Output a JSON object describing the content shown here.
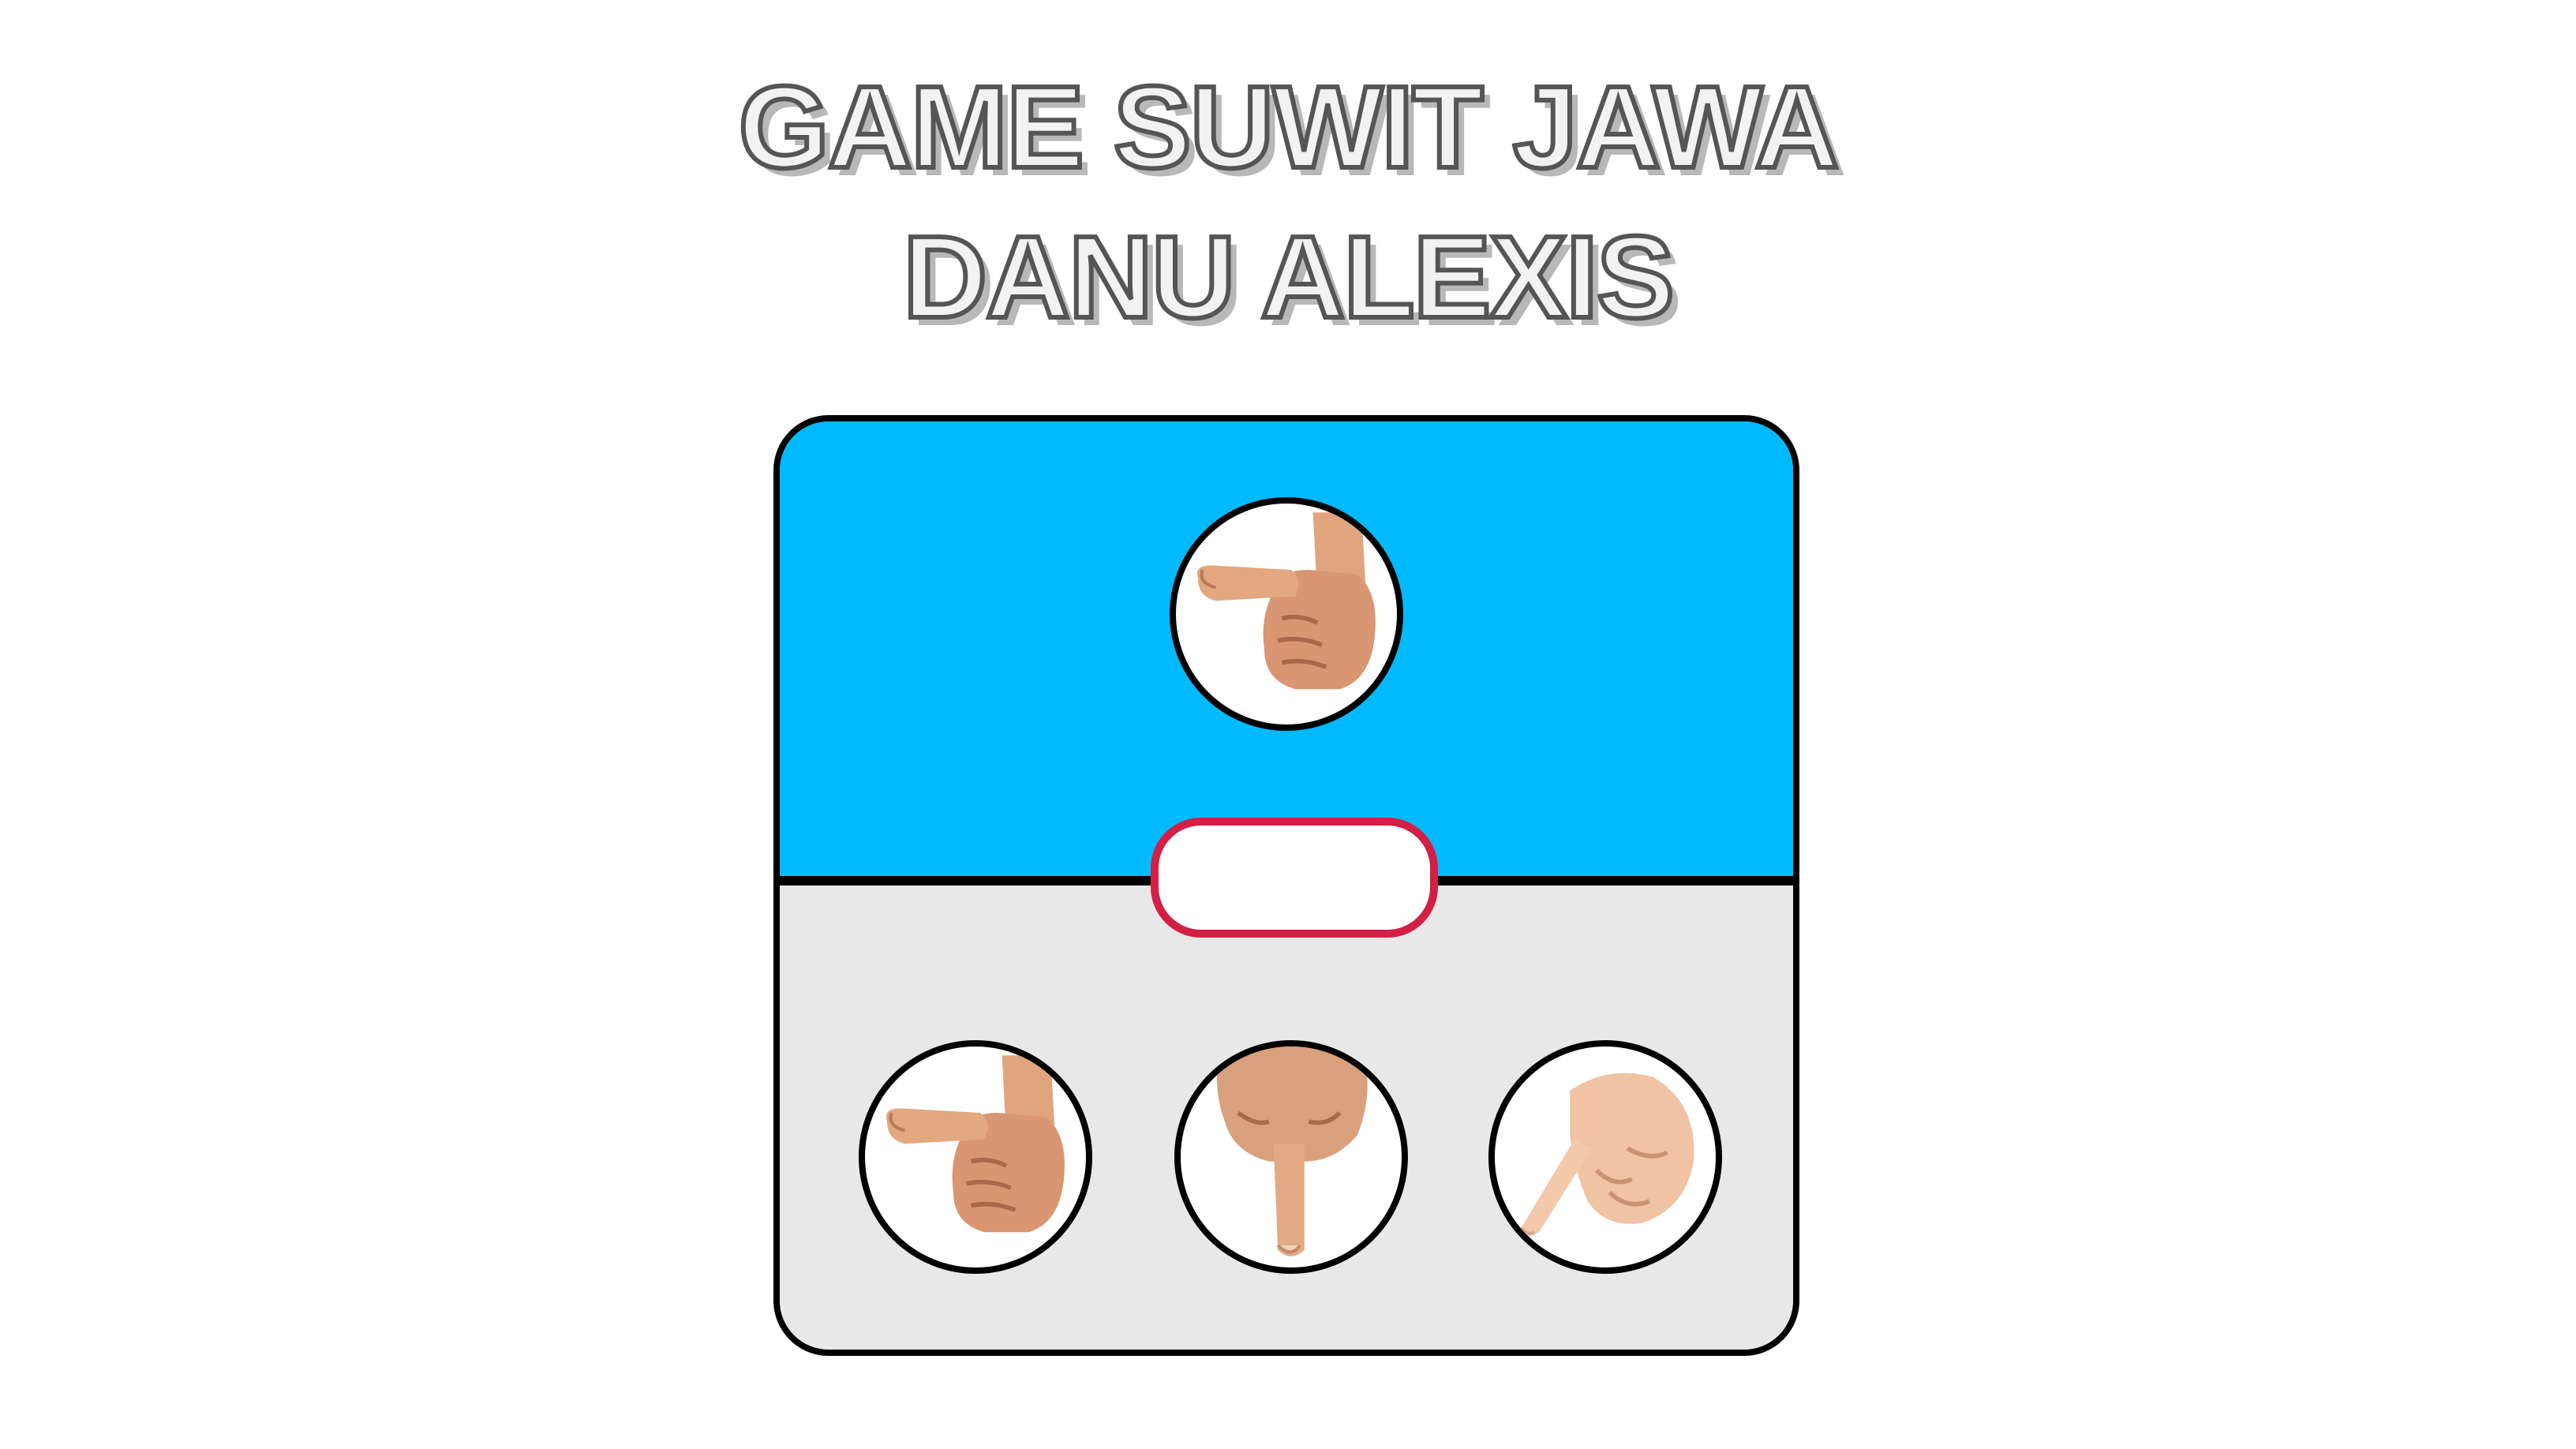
{
  "title": {
    "line1": "GAME SUWIT JAWA",
    "line2": "DANU ALEXIS"
  },
  "colors": {
    "computer_area": "#00b9ff",
    "player_area": "#e8e8e8",
    "result_border": "#d41f45"
  },
  "computer": {
    "choice_icon": "thumb-gajah-icon"
  },
  "result": {
    "text": ""
  },
  "player": {
    "choices": [
      {
        "icon": "thumb-gajah-icon"
      },
      {
        "icon": "index-finger-orang-icon"
      },
      {
        "icon": "pinky-finger-semut-icon"
      }
    ]
  }
}
